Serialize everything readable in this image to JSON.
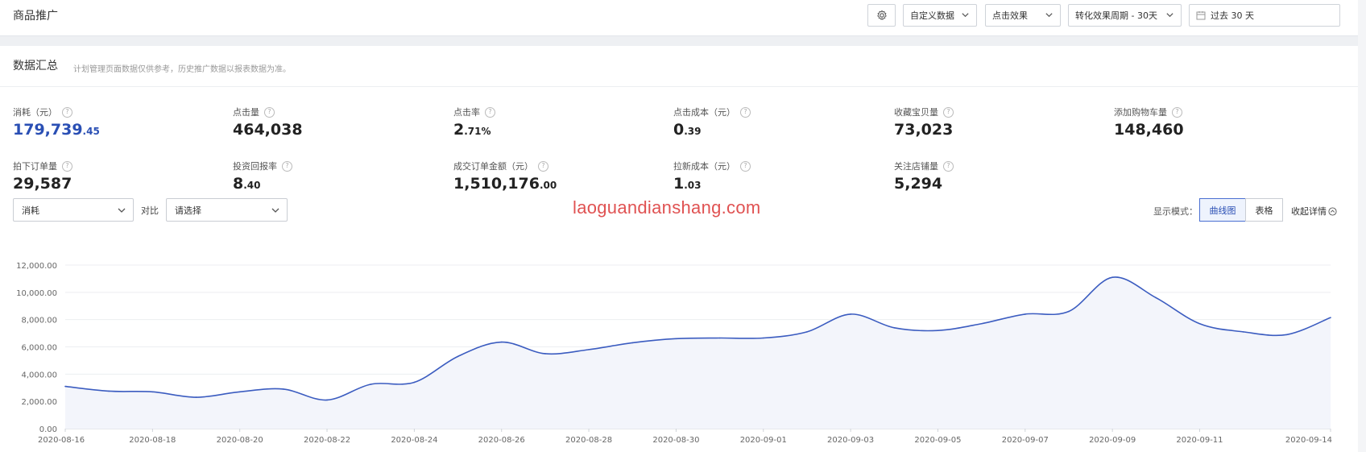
{
  "header": {
    "title": "商品推广",
    "custom_data": "自定义数据",
    "click_effect": "点击效果",
    "conversion_period": "转化效果周期 - 30天",
    "date_range": "过去 30 天"
  },
  "summary": {
    "title": "数据汇总",
    "note": "计划管理页面数据仅供参考，历史推广数据以报表数据为准。",
    "metrics": [
      {
        "label": "消耗（元）",
        "int": "179,739",
        "dec": ".45"
      },
      {
        "label": "点击量",
        "int": "464,038",
        "dec": ""
      },
      {
        "label": "点击率",
        "int": "2",
        "dec": ".71%"
      },
      {
        "label": "点击成本（元）",
        "int": "0",
        "dec": ".39"
      },
      {
        "label": "收藏宝贝量",
        "int": "73,023",
        "dec": ""
      },
      {
        "label": "添加购物车量",
        "int": "148,460",
        "dec": ""
      },
      {
        "label": "拍下订单量",
        "int": "29,587",
        "dec": ""
      },
      {
        "label": "投资回报率",
        "int": "8",
        "dec": ".40"
      },
      {
        "label": "成交订单金额（元）",
        "int": "1,510,176",
        "dec": ".00"
      },
      {
        "label": "拉新成本（元）",
        "int": "1",
        "dec": ".03"
      },
      {
        "label": "关注店铺量",
        "int": "5,294",
        "dec": ""
      }
    ]
  },
  "controls": {
    "metric_select": "消耗",
    "compare_label": "对比",
    "compare_placeholder": "请选择",
    "watermark": "laoguandianshang.com",
    "mode_label": "显示模式：",
    "mode_curve": "曲线图",
    "mode_table": "表格",
    "collapse": "收起详情"
  },
  "colors": {
    "accent": "#2a4fb4",
    "line": "#3b5cc0",
    "area": "#f3f5fb",
    "watermark": "#e05252"
  },
  "chart_data": {
    "type": "line",
    "title": "",
    "xlabel": "",
    "ylabel": "",
    "ylim": [
      0,
      12000
    ],
    "yticks": [
      "0.00",
      "2,000.00",
      "4,000.00",
      "6,000.00",
      "8,000.00",
      "10,000.00",
      "12,000.00"
    ],
    "x": [
      "2020-08-16",
      "2020-08-17",
      "2020-08-18",
      "2020-08-19",
      "2020-08-20",
      "2020-08-21",
      "2020-08-22",
      "2020-08-23",
      "2020-08-24",
      "2020-08-25",
      "2020-08-26",
      "2020-08-27",
      "2020-08-28",
      "2020-08-29",
      "2020-08-30",
      "2020-08-31",
      "2020-09-01",
      "2020-09-02",
      "2020-09-03",
      "2020-09-04",
      "2020-09-05",
      "2020-09-06",
      "2020-09-07",
      "2020-09-08",
      "2020-09-09",
      "2020-09-10",
      "2020-09-11",
      "2020-09-12",
      "2020-09-13",
      "2020-09-14"
    ],
    "xtick_labels": [
      "2020-08-16",
      "2020-08-18",
      "2020-08-20",
      "2020-08-22",
      "2020-08-24",
      "2020-08-26",
      "2020-08-28",
      "2020-08-30",
      "2020-09-01",
      "2020-09-03",
      "2020-09-05",
      "2020-09-07",
      "2020-09-09",
      "2020-09-11",
      "2020-09-14"
    ],
    "series": [
      {
        "values": [
          3100,
          2750,
          2700,
          2300,
          2700,
          2900,
          2100,
          3250,
          3400,
          5300,
          6350,
          5500,
          5800,
          6300,
          6600,
          6650,
          6650,
          7100,
          8400,
          7400,
          7200,
          7700,
          8400,
          8600,
          11100,
          9600,
          7700,
          7100,
          6900,
          8150
        ]
      }
    ],
    "grid": true,
    "legend": "none",
    "area_fill": true
  }
}
